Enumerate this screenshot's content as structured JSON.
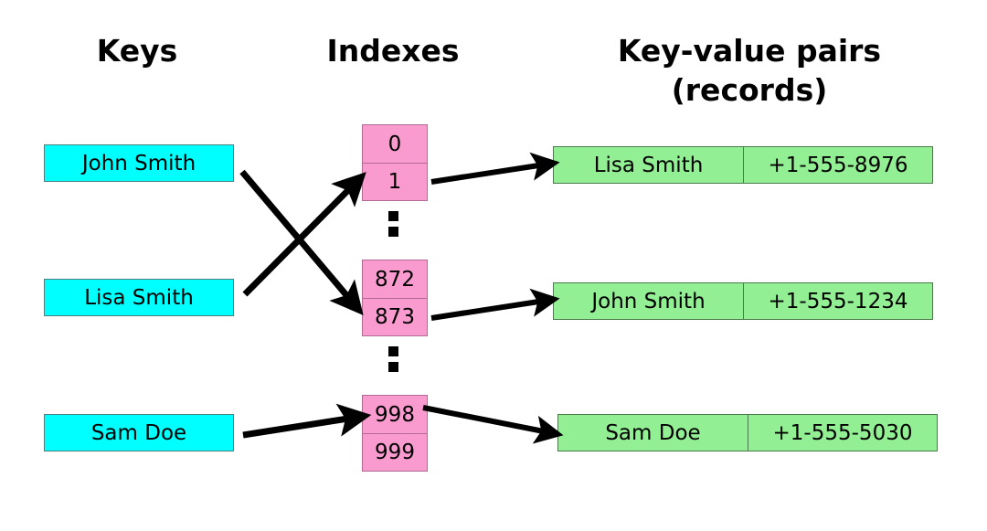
{
  "headings": {
    "keys": "Keys",
    "indexes": "Indexes",
    "records": "Key-value pairs\n(records)"
  },
  "colors": {
    "key_fill": "#00FFFF",
    "key_stroke": "#4D7F7F",
    "index_fill": "#FA9BD0",
    "index_stroke": "#B06A93",
    "record_fill": "#93EF93",
    "record_stroke": "#4A7A4A",
    "arrow": "#000000",
    "background": "#FFFFFF",
    "text": "#000000"
  },
  "keys": [
    {
      "label": "John Smith"
    },
    {
      "label": "Lisa Smith"
    },
    {
      "label": "Sam Doe"
    }
  ],
  "index_groups": [
    {
      "cells": [
        "0",
        "1"
      ]
    },
    {
      "cells": [
        "872",
        "873"
      ]
    },
    {
      "cells": [
        "998",
        "999"
      ]
    }
  ],
  "ellipsis": {
    "glyph": "vertical-ellipsis",
    "dots": 2
  },
  "records": [
    {
      "name": "Lisa Smith",
      "value": "+1-555-8976"
    },
    {
      "name": "John Smith",
      "value": "+1-555-1234"
    },
    {
      "name": "Sam Doe",
      "value": "+1-555-5030"
    }
  ],
  "arrows": [
    {
      "from": "key-john-smith",
      "to": "index-873"
    },
    {
      "from": "key-lisa-smith",
      "to": "index-1"
    },
    {
      "from": "key-sam-doe",
      "to": "index-998"
    },
    {
      "from": "index-1",
      "to": "record-lisa-smith"
    },
    {
      "from": "index-873",
      "to": "record-john-smith"
    },
    {
      "from": "index-998",
      "to": "record-sam-doe"
    }
  ]
}
